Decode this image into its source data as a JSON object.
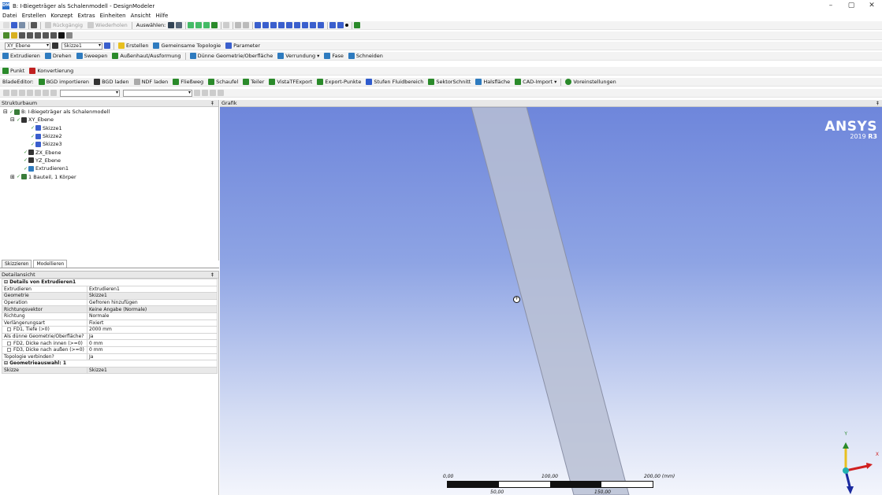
{
  "window": {
    "title": "B: I-Biegeträger als Schalenmodell - DesignModeler",
    "app_icon": "DM",
    "controls": [
      "–",
      "▢",
      "✕"
    ]
  },
  "menu": [
    "Datei",
    "Erstellen",
    "Konzept",
    "Extras",
    "Einheiten",
    "Ansicht",
    "Hilfe"
  ],
  "toolbar1": {
    "undo": "Rückgängig",
    "redo": "Wiederholen",
    "select_label": "Auswählen:"
  },
  "toolbar3": {
    "plane": "XY_Ebene",
    "sketch": "Skizze1",
    "create": "Erstellen",
    "shared_topology": "Gemeinsame Topologie",
    "parameter": "Parameter"
  },
  "toolbar4": {
    "extrude": "Extrudieren",
    "revolve": "Drehen",
    "sweep": "Sweepen",
    "skin": "Außenhaut/Ausformung",
    "thin": "Dünne Geometrie/Oberfläche",
    "blend": "Verrundung",
    "chamfer": "Fase",
    "slice": "Schneiden"
  },
  "toolbar5": {
    "point": "Punkt",
    "conversion": "Konvertierung"
  },
  "toolbar6": {
    "label": "BladeEditor:",
    "items": [
      "BGD importieren",
      "BGD laden",
      "NDF laden",
      "Fließweg",
      "Schaufel",
      "Teiler",
      "VistaTFExport",
      "Export-Punkte",
      "Stufen Fluidbereich",
      "SektorSchnitt",
      "Halsfläche",
      "CAD-Import",
      "Voreinstellungen"
    ]
  },
  "tree": {
    "header": "Strukturbaum",
    "pin": "‡",
    "items": [
      {
        "label": "B: I-Biegeträger als Schalenmodell",
        "indent": 0,
        "expander": "⊟",
        "icon_color": "#3a7d3a"
      },
      {
        "label": "XY_Ebene",
        "indent": 1,
        "expander": "⊟",
        "icon_color": "#333333"
      },
      {
        "label": "Skizze1",
        "indent": 3,
        "expander": "",
        "icon_color": "#3a5fcd"
      },
      {
        "label": "Skizze2",
        "indent": 3,
        "expander": "",
        "icon_color": "#3a5fcd"
      },
      {
        "label": "Skizze3",
        "indent": 3,
        "expander": "",
        "icon_color": "#3a5fcd"
      },
      {
        "label": "ZX_Ebene",
        "indent": 2,
        "expander": "",
        "icon_color": "#333333"
      },
      {
        "label": "YZ_Ebene",
        "indent": 2,
        "expander": "",
        "icon_color": "#333333"
      },
      {
        "label": "Extrudieren1",
        "indent": 2,
        "expander": "",
        "icon_color": "#2e7bbf"
      },
      {
        "label": "1 Bauteil, 1 Körper",
        "indent": 1,
        "expander": "⊞",
        "icon_color": "#3a7d3a"
      }
    ]
  },
  "tabs": [
    "Skizzieren",
    "Modellieren"
  ],
  "details": {
    "header": "Detailansicht",
    "pin": "‡",
    "rows": [
      {
        "type": "section",
        "label": "Details von Extrudieren1"
      },
      {
        "label": "Extrudieren",
        "value": "Extrudieren1"
      },
      {
        "label": "Geometrie",
        "value": "Skizze1",
        "highlight": true
      },
      {
        "label": "Operation",
        "value": "Gefroren hinzufügen"
      },
      {
        "label": "Richtungsvektor",
        "value": "Keine Angabe (Normale)",
        "highlight": true
      },
      {
        "label": "Richtung",
        "value": "Normale"
      },
      {
        "label": "Verlängerungsart",
        "value": "Fixiert"
      },
      {
        "label": "FD1, Tiefe (>0)",
        "value": "2000 mm",
        "checkbox": true
      },
      {
        "label": "Als dünne Geometrie/Oberfläche?",
        "value": "Ja"
      },
      {
        "label": "FD2, Dicke nach innen (>=0)",
        "value": "0 mm",
        "checkbox": true
      },
      {
        "label": "FD3, Dicke nach außen (>=0)",
        "value": "0 mm",
        "checkbox": true
      },
      {
        "label": "Topologie verbinden?",
        "value": "Ja"
      },
      {
        "type": "section",
        "label": "Geometrieauswahl: 1"
      },
      {
        "label": "Skizze",
        "value": "Skizze1",
        "highlight": true
      }
    ]
  },
  "graphics": {
    "header": "Grafik",
    "pin": "‡",
    "logo": "ANSYS",
    "version_prefix": "2019 ",
    "version_bold": "R3",
    "scale": {
      "labels": [
        "0,00",
        "100,00",
        "200,00 (mm)"
      ],
      "sub_labels": [
        "50,00",
        "150,00"
      ]
    },
    "triad": {
      "x": "X",
      "y": "Y"
    },
    "colors": {
      "bg_top": "#6e86db",
      "bg_bottom": "#f3f5fc",
      "body": "#b9bfd4"
    }
  }
}
